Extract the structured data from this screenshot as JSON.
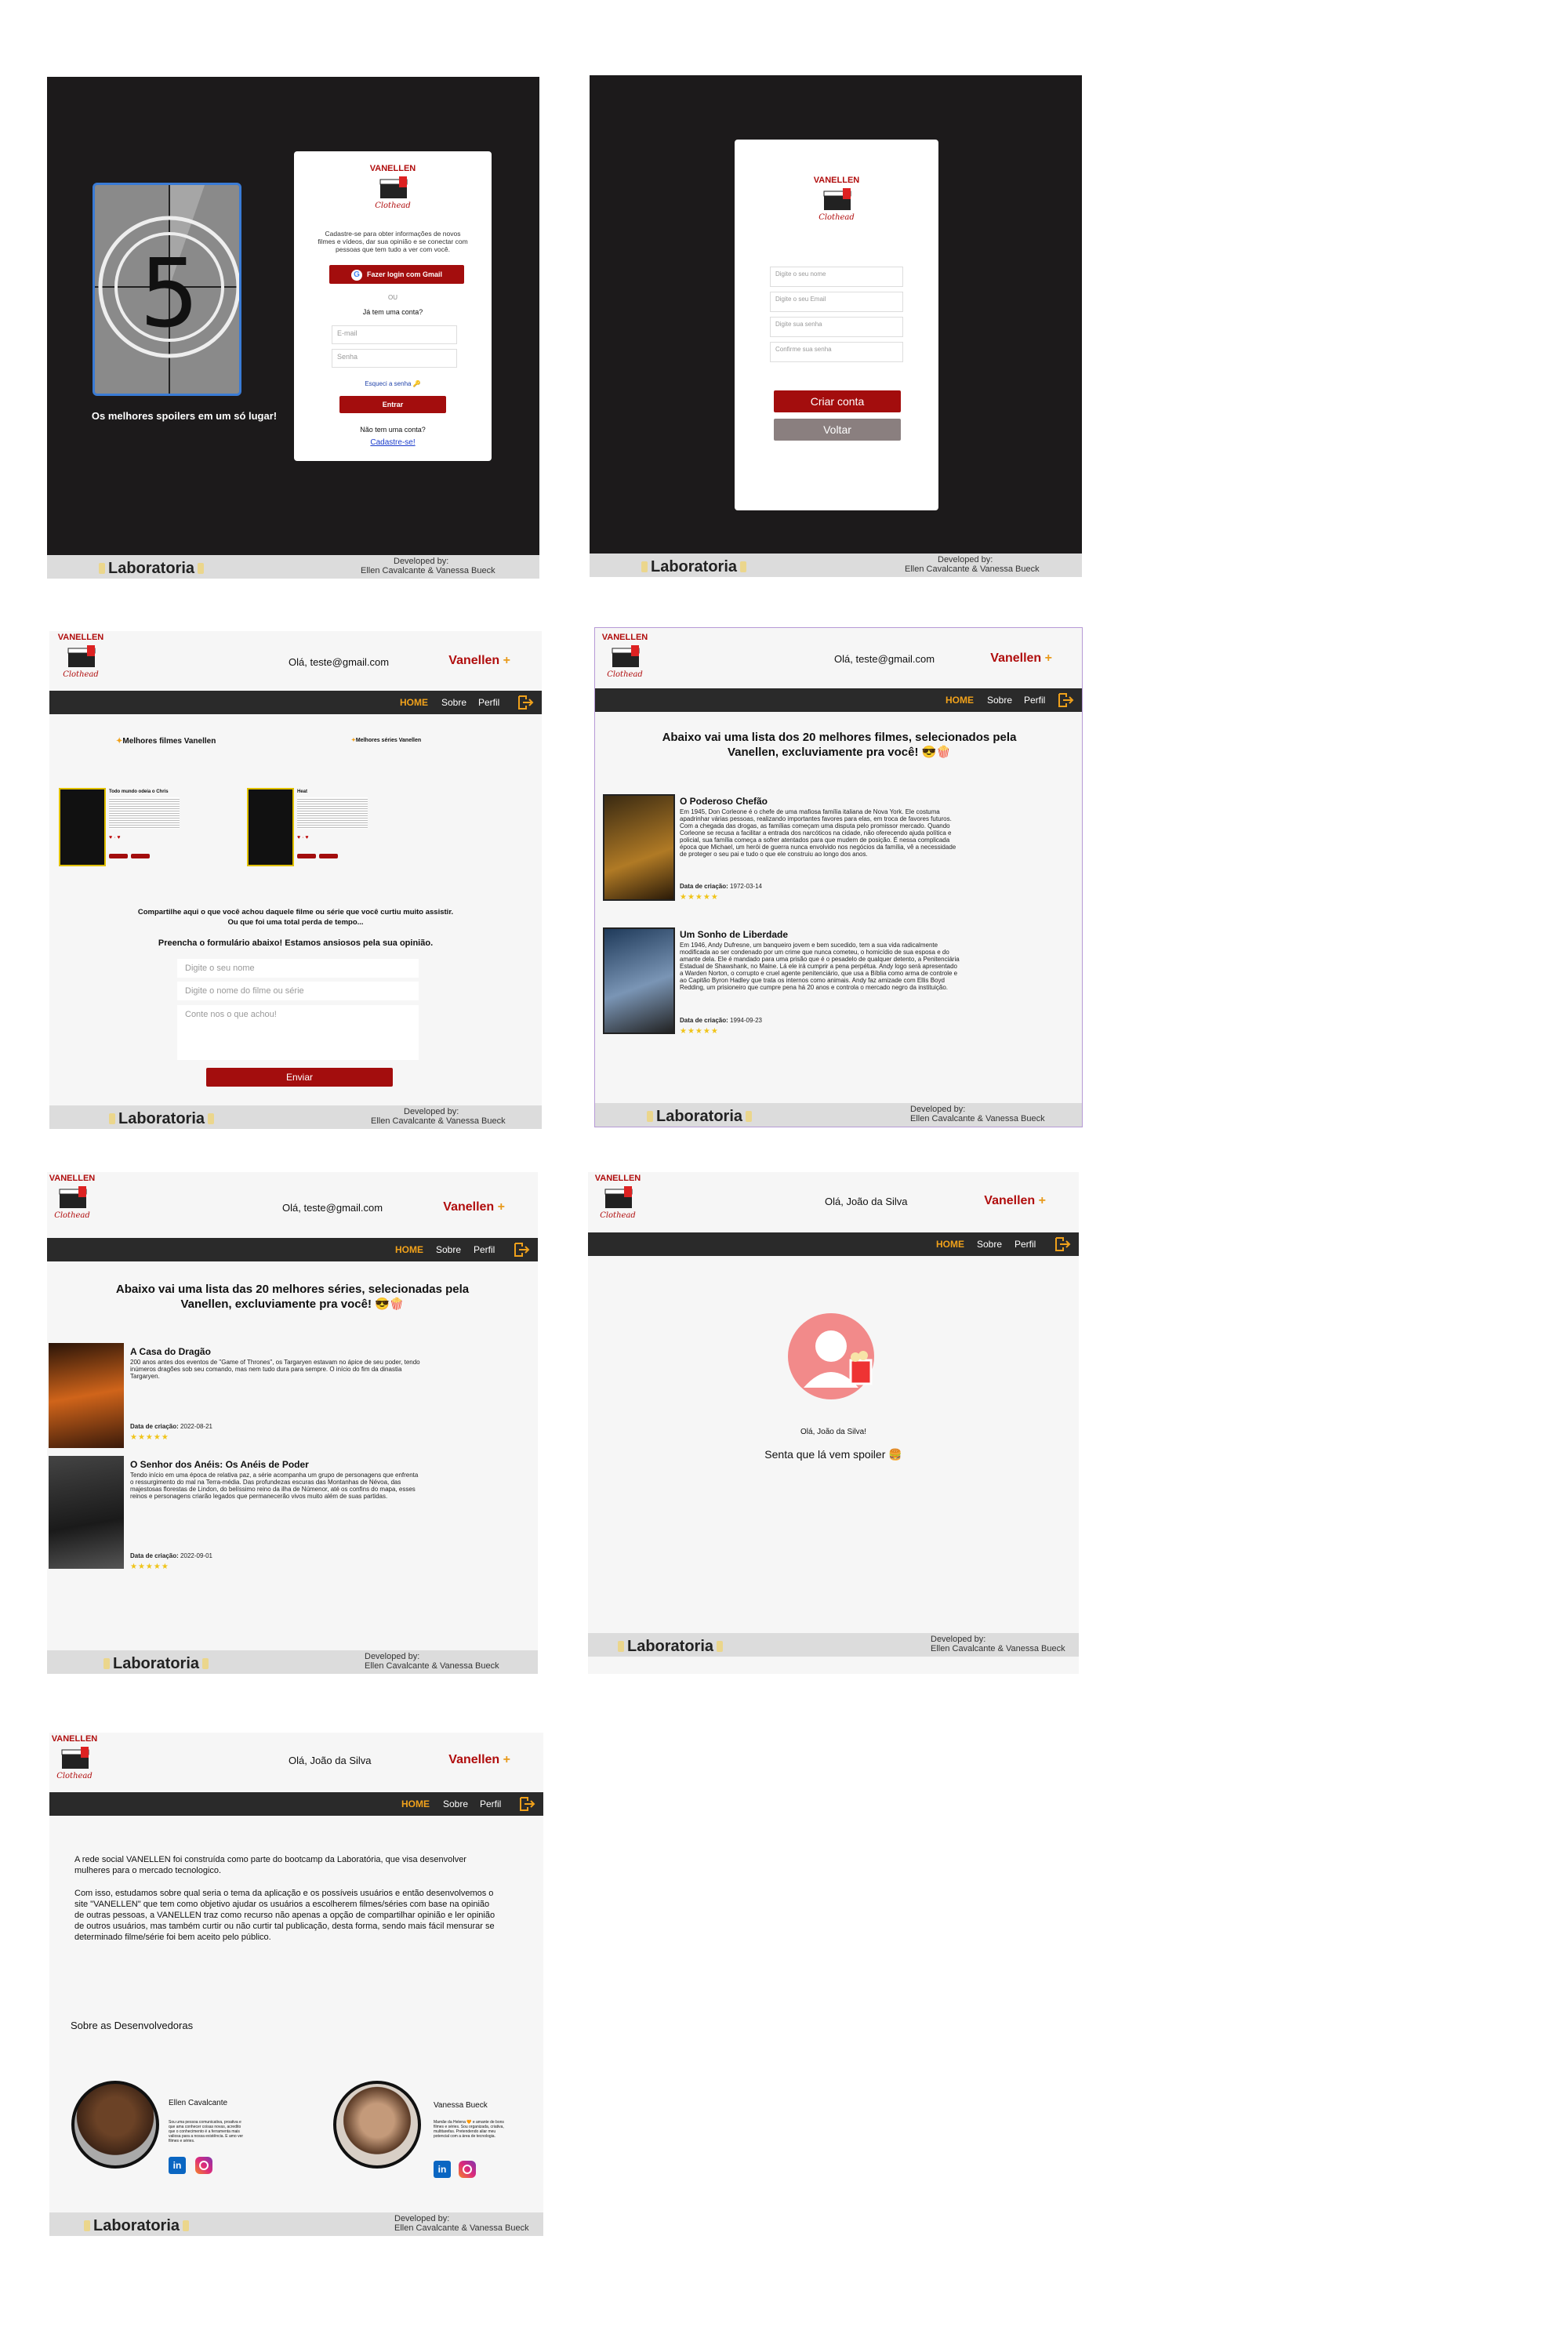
{
  "brand": {
    "logo_top": "VANELLEN",
    "logo_script": "Clothead",
    "name": "Vanellen",
    "accent": "#b00d0d",
    "orange": "#f0a11b"
  },
  "footer": {
    "lab": "Laboratoria",
    "dev_label": "Developed by:",
    "dev_names": "Ellen Cavalcante & Vanessa Bueck"
  },
  "nav": {
    "home": "HOME",
    "about": "Sobre",
    "profile": "Perfil",
    "logout_icon": "logout-icon"
  },
  "login": {
    "tagline": "Os melhores spoilers em um só lugar!",
    "countdown": "5",
    "intro": "Cadastre-se para obter informações de novos filmes e vídeos, dar sua opinião e se conectar com pessoas que tem tudo a ver com você.",
    "google_btn": "Fazer login com Gmail",
    "or": "OU",
    "has_account": "Já tem uma conta?",
    "email_ph": "E-mail",
    "password_ph": "Senha",
    "forgot": "Esqueci a senha",
    "enter_btn": "Entrar",
    "no_account": "Não tem uma conta?",
    "signup_link": "Cadastre-se!"
  },
  "register": {
    "name_ph": "Digite o seu nome",
    "email_ph": "Digite o seu Email",
    "pass_ph": "Digite sua senha",
    "confirm_ph": "Confirme sua senha",
    "create_btn": "Criar conta",
    "back_btn": "Voltar"
  },
  "home": {
    "hello": "Olá, teste@gmail.com",
    "best_movies": "Melhores filmes Vanellen",
    "best_series": "Melhores séries Vanellen",
    "card1_title": "Todo mundo odeia o Chris",
    "card2_title": "Heat",
    "share1": "Compartilhe aqui o que você achou daquele filme ou série que você curtiu muito assistir.",
    "share2": "Ou que foi uma total perda de tempo...",
    "fill": "Preencha o formulário abaixo! Estamos ansiosos pela sua opinião.",
    "name_ph": "Digite o seu nome",
    "title_ph": "Digite o nome do filme ou série",
    "opinion_ph": "Conte nos o que achou!",
    "send_btn": "Enviar"
  },
  "movies": {
    "hello": "Olá, teste@gmail.com",
    "heading": "Abaixo vai uma lista dos 20 melhores filmes, selecionados pela Vanellen, excluviamente pra você! 😎🍿",
    "items": [
      {
        "title": "O Poderoso Chefão",
        "text": "Em 1945, Don Corleone é o chefe de uma mafiosa família italiana de Nova York. Ele costuma apadrinhar várias pessoas, realizando importantes favores para elas, em troca de favores futuros. Com a chegada das drogas, as famílias começam uma disputa pelo promissor mercado. Quando Corleone se recusa a facilitar a entrada dos narcóticos na cidade, não oferecendo ajuda política e policial, sua família começa a sofrer atentados para que mudem de posição. É nessa complicada época que Michael, um herói de guerra nunca envolvido nos negócios da família, vê a necessidade de proteger o seu pai e tudo o que ele construiu ao longo dos anos.",
        "date_label": "Data de criação:",
        "date": "1972-03-14",
        "stars": "★★★★★"
      },
      {
        "title": "Um Sonho de Liberdade",
        "text": "Em 1946, Andy Dufresne, um banqueiro jovem e bem sucedido, tem a sua vida radicalmente modificada ao ser condenado por um crime que nunca cometeu, o homicídio de sua esposa e do amante dela. Ele é mandado para uma prisão que é o pesadelo de qualquer detento, a Penitenciária Estadual de Shawshank, no Maine. Lá ele irá cumprir a pena perpétua. Andy logo será apresentado a Warden Norton, o corrupto e cruel agente penitenciário, que usa a Bíblia como arma de controle e ao Capitão Byron Hadley que trata os internos como animais. Andy faz amizade com Ellis Boyd Redding, um prisioneiro que cumpre pena há 20 anos e controla o mercado negro da instituição.",
        "date_label": "Data de criação:",
        "date": "1994-09-23",
        "stars": "★★★★★"
      }
    ]
  },
  "series": {
    "hello": "Olá, teste@gmail.com",
    "heading": "Abaixo vai uma lista das 20 melhores séries, selecionadas pela Vanellen, excluviamente pra você! 😎🍿",
    "items": [
      {
        "title": "A Casa do Dragão",
        "text": "200 anos antes dos eventos de \"Game of Thrones\", os Targaryen estavam no ápice de seu poder, tendo inúmeros dragões sob seu comando, mas nem tudo dura para sempre. O início do fim da dinastia Targaryen.",
        "date_label": "Data de criação:",
        "date": "2022-08-21",
        "stars": "★★★★★"
      },
      {
        "title": "O Senhor dos Anéis: Os Anéis de Poder",
        "text": "Tendo início em uma época de relativa paz, a série acompanha um grupo de personagens que enfrenta o ressurgimento do mal na Terra-média. Das profundezas escuras das Montanhas de Névoa, das majestosas florestas de Lindon, do belíssimo reino da ilha de Númenor, até os confins do mapa, esses reinos e personagens criarão legados que permanecerão vivos muito além de suas partidas.",
        "date_label": "Data de criação:",
        "date": "2022-09-01",
        "stars": "★★★★★"
      }
    ]
  },
  "profile": {
    "hello": "Olá, João da Silva",
    "greeting": "Olá, João da Silva!",
    "spoiler": "Senta que lá vem spoiler 🍔"
  },
  "about": {
    "hello": "Olá, João da Silva",
    "p1": "A rede social VANELLEN foi construída como parte do bootcamp da Laboratória, que visa desenvolver mulheres para o mercado tecnologico.",
    "p2": "Com isso, estudamos sobre qual seria o tema da aplicação e os possíveis usuários e então desenvolvemos o site \"VANELLEN\" que tem como objetivo ajudar os usuários a escolherem filmes/séries com base na opinião de outras pessoas, a VANELLEN traz como recurso não apenas a opção de compartilhar opinião e ler opinião de outros usuários, mas também curtir ou não curtir tal publicação, desta forma, sendo mais fácil mensurar se determinado filme/série foi bem aceito pelo público.",
    "devs_title": "Sobre as Desenvolvedoras",
    "dev1_name": "Ellen Cavalcante",
    "dev1_bio": "Sou uma pessoa comunicativa, proativa e que ama conhecer coisas novas, acredito que o conhecimento é a ferramenta mais valiosa para a nossa existência. E amo ver filmes e séries.",
    "dev2_name": "Vanessa Bueck",
    "dev2_bio": "Mamãe da Helena 🧡 e amante de bons filmes e séries. Sou organizada, criativa, multitarefas. Pretendendo aliar meu potencial com a área de tecnologia."
  }
}
